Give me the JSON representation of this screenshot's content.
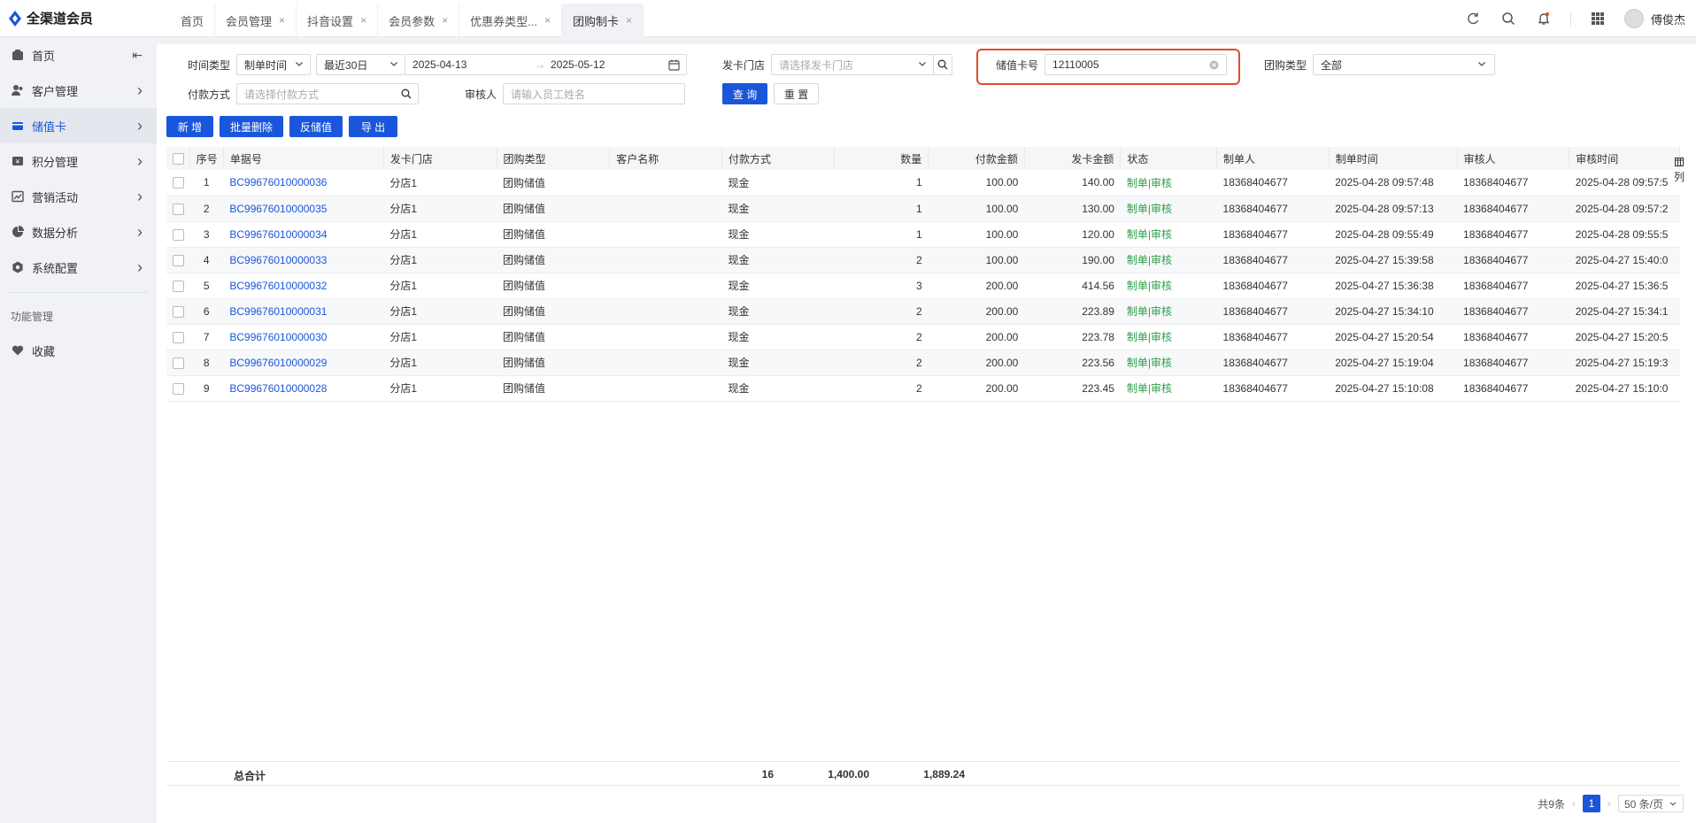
{
  "app": {
    "name": "全渠道会员"
  },
  "tabs": [
    {
      "label": "首页",
      "closable": false
    },
    {
      "label": "会员管理",
      "closable": true
    },
    {
      "label": "抖音设置",
      "closable": true
    },
    {
      "label": "会员参数",
      "closable": true
    },
    {
      "label": "优惠券类型...",
      "closable": true
    },
    {
      "label": "团购制卡",
      "closable": true,
      "active": true
    }
  ],
  "header": {
    "user_name": "傅俊杰"
  },
  "sidebar": {
    "items": [
      {
        "label": "首页",
        "icon": "home-icon"
      },
      {
        "label": "客户管理",
        "icon": "users-icon"
      },
      {
        "label": "储值卡",
        "icon": "card-icon",
        "active": true
      },
      {
        "label": "积分管理",
        "icon": "points-icon"
      },
      {
        "label": "营销活动",
        "icon": "chart-icon"
      },
      {
        "label": "数据分析",
        "icon": "pie-icon"
      },
      {
        "label": "系统配置",
        "icon": "settings-icon"
      }
    ],
    "group_label": "功能管理",
    "favorite_label": "收藏"
  },
  "filters": {
    "time_type_label": "时间类型",
    "time_type_value": "制单时间",
    "range_value": "最近30日",
    "date_start": "2025-04-13",
    "date_end": "2025-05-12",
    "store_label": "发卡门店",
    "store_placeholder": "请选择发卡门店",
    "card_no_label": "储值卡号",
    "card_no_value": "12110005",
    "group_type_label": "团购类型",
    "group_type_value": "全部",
    "pay_method_label": "付款方式",
    "pay_method_placeholder": "请选择付款方式",
    "reviewer_label": "审核人",
    "reviewer_placeholder": "请输入员工姓名",
    "query_label": "查 询",
    "reset_label": "重 置"
  },
  "toolbar": {
    "add_label": "新 增",
    "batch_delete_label": "批量删除",
    "reverse_label": "反储值",
    "export_label": "导 出"
  },
  "table": {
    "columns": [
      "序号",
      "单据号",
      "发卡门店",
      "团购类型",
      "客户名称",
      "付款方式",
      "数量",
      "付款金额",
      "发卡金额",
      "状态",
      "制单人",
      "制单时间",
      "审核人",
      "审核时间"
    ],
    "rows": [
      {
        "no": "1",
        "doc": "BC99676010000036",
        "store": "分店1",
        "type": "团购储值",
        "customer": "",
        "pay": "现金",
        "qty": "1",
        "paid": "100.00",
        "issued": "140.00",
        "status": "制单|审核",
        "maker": "18368404677",
        "make_time": "2025-04-28 09:57:48",
        "reviewer": "18368404677",
        "review_time": "2025-04-28 09:57:5"
      },
      {
        "no": "2",
        "doc": "BC99676010000035",
        "store": "分店1",
        "type": "团购储值",
        "customer": "",
        "pay": "现金",
        "qty": "1",
        "paid": "100.00",
        "issued": "130.00",
        "status": "制单|审核",
        "maker": "18368404677",
        "make_time": "2025-04-28 09:57:13",
        "reviewer": "18368404677",
        "review_time": "2025-04-28 09:57:2"
      },
      {
        "no": "3",
        "doc": "BC99676010000034",
        "store": "分店1",
        "type": "团购储值",
        "customer": "",
        "pay": "现金",
        "qty": "1",
        "paid": "100.00",
        "issued": "120.00",
        "status": "制单|审核",
        "maker": "18368404677",
        "make_time": "2025-04-28 09:55:49",
        "reviewer": "18368404677",
        "review_time": "2025-04-28 09:55:5"
      },
      {
        "no": "4",
        "doc": "BC99676010000033",
        "store": "分店1",
        "type": "团购储值",
        "customer": "",
        "pay": "现金",
        "qty": "2",
        "paid": "100.00",
        "issued": "190.00",
        "status": "制单|审核",
        "maker": "18368404677",
        "make_time": "2025-04-27 15:39:58",
        "reviewer": "18368404677",
        "review_time": "2025-04-27 15:40:0"
      },
      {
        "no": "5",
        "doc": "BC99676010000032",
        "store": "分店1",
        "type": "团购储值",
        "customer": "",
        "pay": "现金",
        "qty": "3",
        "paid": "200.00",
        "issued": "414.56",
        "status": "制单|审核",
        "maker": "18368404677",
        "make_time": "2025-04-27 15:36:38",
        "reviewer": "18368404677",
        "review_time": "2025-04-27 15:36:5"
      },
      {
        "no": "6",
        "doc": "BC99676010000031",
        "store": "分店1",
        "type": "团购储值",
        "customer": "",
        "pay": "现金",
        "qty": "2",
        "paid": "200.00",
        "issued": "223.89",
        "status": "制单|审核",
        "maker": "18368404677",
        "make_time": "2025-04-27 15:34:10",
        "reviewer": "18368404677",
        "review_time": "2025-04-27 15:34:1"
      },
      {
        "no": "7",
        "doc": "BC99676010000030",
        "store": "分店1",
        "type": "团购储值",
        "customer": "",
        "pay": "现金",
        "qty": "2",
        "paid": "200.00",
        "issued": "223.78",
        "status": "制单|审核",
        "maker": "18368404677",
        "make_time": "2025-04-27 15:20:54",
        "reviewer": "18368404677",
        "review_time": "2025-04-27 15:20:5"
      },
      {
        "no": "8",
        "doc": "BC99676010000029",
        "store": "分店1",
        "type": "团购储值",
        "customer": "",
        "pay": "现金",
        "qty": "2",
        "paid": "200.00",
        "issued": "223.56",
        "status": "制单|审核",
        "maker": "18368404677",
        "make_time": "2025-04-27 15:19:04",
        "reviewer": "18368404677",
        "review_time": "2025-04-27 15:19:3"
      },
      {
        "no": "9",
        "doc": "BC99676010000028",
        "store": "分店1",
        "type": "团购储值",
        "customer": "",
        "pay": "现金",
        "qty": "2",
        "paid": "200.00",
        "issued": "223.45",
        "status": "制单|审核",
        "maker": "18368404677",
        "make_time": "2025-04-27 15:10:08",
        "reviewer": "18368404677",
        "review_time": "2025-04-27 15:10:0"
      }
    ],
    "totals": {
      "label": "总合计",
      "qty": "16",
      "paid": "1,400.00",
      "issued": "1,889.24"
    },
    "column_setting_label": "列"
  },
  "pagination": {
    "total_text": "共9条",
    "current_page": "1",
    "page_size": "50 条/页"
  },
  "colors": {
    "primary": "#1a56db",
    "status_green": "#2e9e4a",
    "highlight_border": "#e04a2b"
  }
}
